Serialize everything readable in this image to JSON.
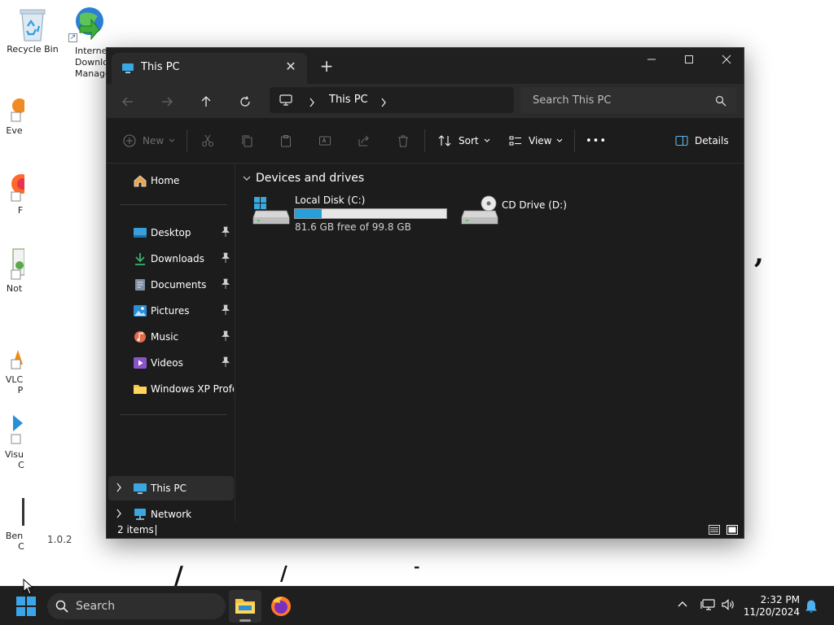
{
  "desktop": {
    "icons": [
      {
        "label": "Recycle Bin"
      },
      {
        "label": "Internet Download Manager"
      }
    ],
    "clipped_labels": [
      "Eve",
      "F",
      "Not",
      "VLC",
      "P",
      "Visu",
      "C",
      "Ben",
      "C"
    ],
    "version_text": "1.0.2"
  },
  "explorer": {
    "tab_title": "This PC",
    "tab_close": "✕",
    "new_tab": "+",
    "window_controls": {
      "minimize": "─",
      "maximize": "☐",
      "close": "✕"
    },
    "breadcrumb": "This PC",
    "search_placeholder": "Search This PC",
    "toolbar": {
      "new_label": "New",
      "sort_label": "Sort",
      "view_label": "View",
      "more_label": "•••",
      "details_label": "Details"
    },
    "sidebar": {
      "home": "Home",
      "quick_access": [
        {
          "label": "Desktop"
        },
        {
          "label": "Downloads"
        },
        {
          "label": "Documents"
        },
        {
          "label": "Pictures"
        },
        {
          "label": "Music"
        },
        {
          "label": "Videos"
        },
        {
          "label": "Windows XP Profes"
        }
      ],
      "this_pc": "This PC",
      "network": "Network"
    },
    "content": {
      "group_title": "Devices and drives",
      "drives": [
        {
          "name": "Local Disk (C:)",
          "free_text": "81.6 GB free of 99.8 GB",
          "used_fraction": 0.18
        },
        {
          "name": "CD Drive (D:)"
        }
      ]
    },
    "status": {
      "items": "2 items"
    }
  },
  "taskbar": {
    "search_placeholder": "Search",
    "clock_time": "2:32 PM",
    "clock_date": "11/20/2024"
  }
}
